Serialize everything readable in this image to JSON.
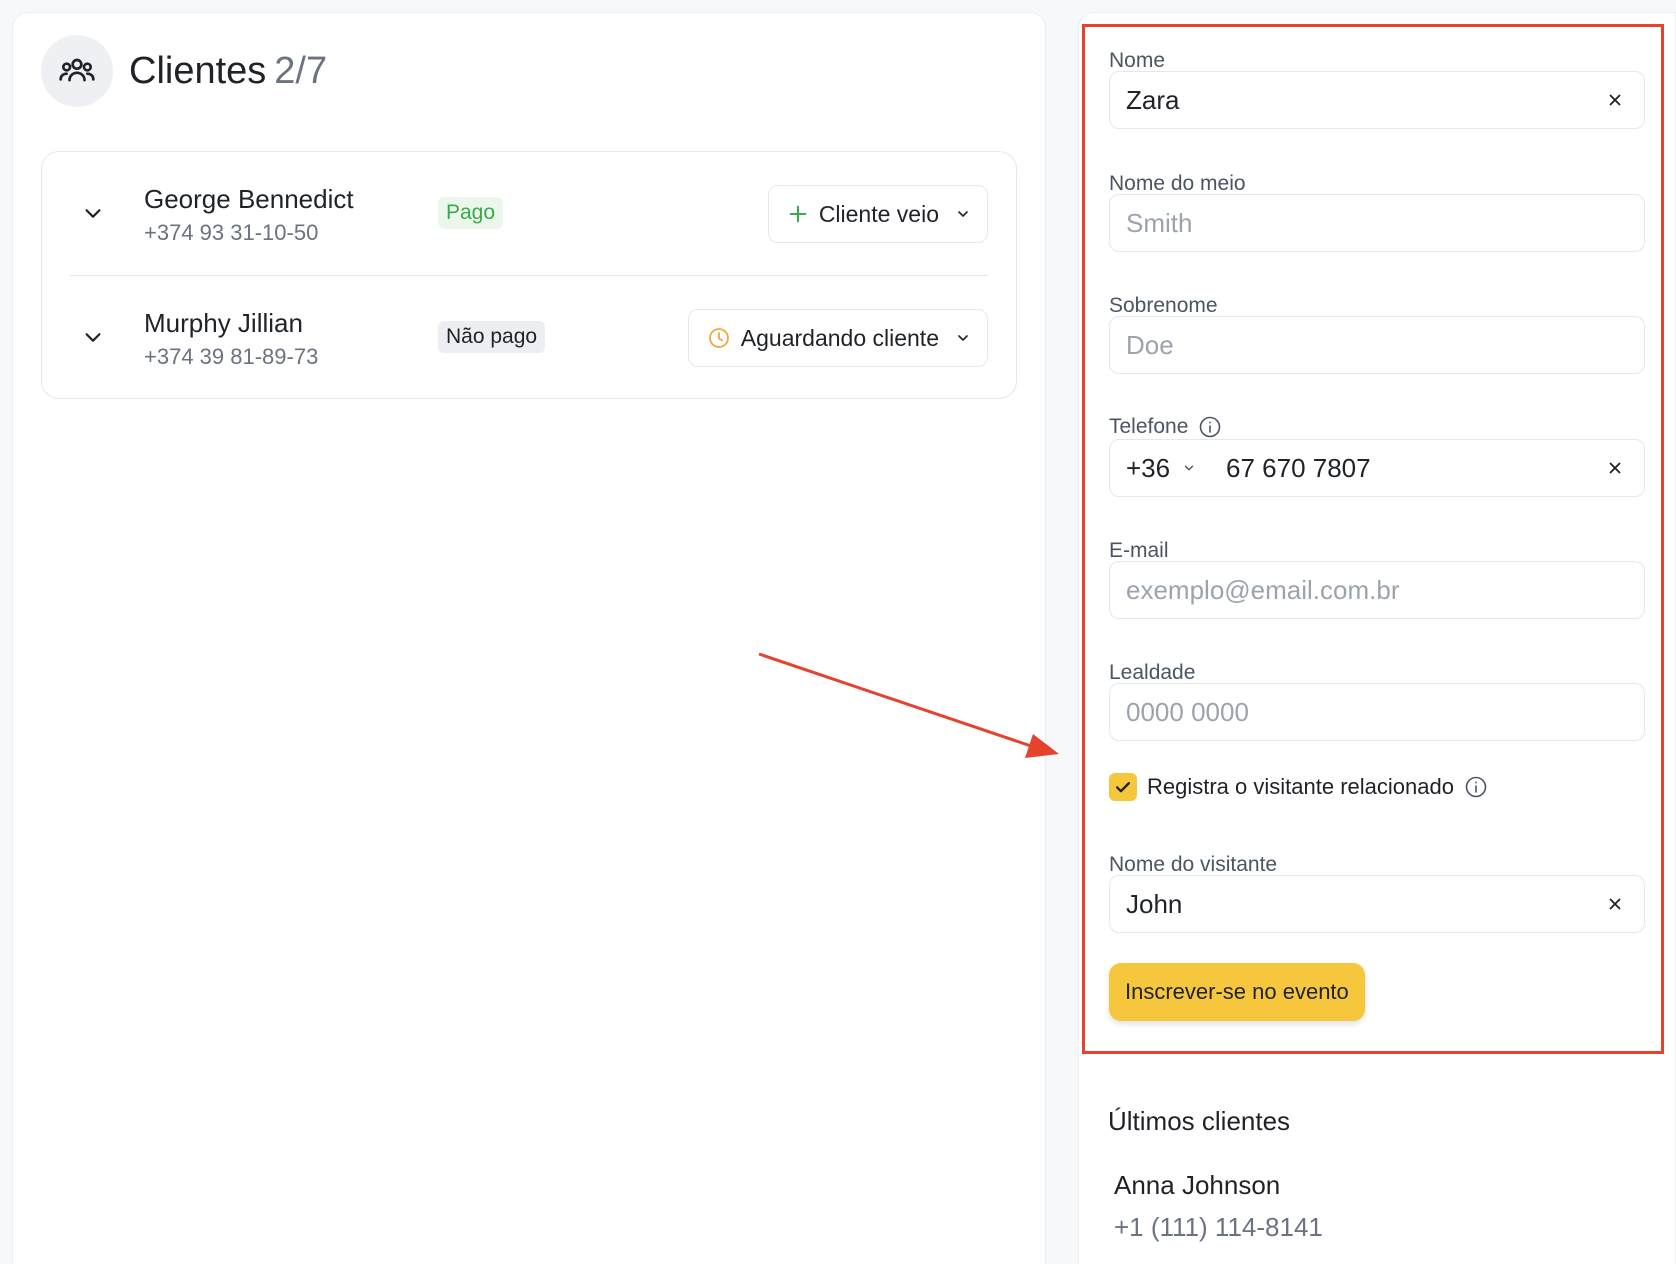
{
  "header": {
    "title": "Clientes",
    "count": "2/7",
    "icon": "users-icon"
  },
  "clients": [
    {
      "name": "George Bennedict",
      "phone": "+374 93 31-10-50",
      "badge": "Pago",
      "status": "Cliente veio",
      "status_icon": "plus-icon"
    },
    {
      "name": "Murphy Jillian",
      "phone": "+374 39 81-89-73",
      "badge": "Não pago",
      "status": "Aguardando cliente",
      "status_icon": "clock-icon"
    }
  ],
  "form": {
    "first_name": {
      "label": "Nome",
      "value": "Zara",
      "placeholder": ""
    },
    "middle_name": {
      "label": "Nome do meio",
      "value": "",
      "placeholder": "Smith"
    },
    "last_name": {
      "label": "Sobrenome",
      "value": "",
      "placeholder": "Doe"
    },
    "phone": {
      "label": "Telefone",
      "code": "+36",
      "value": "67 670 7807",
      "placeholder": ""
    },
    "email": {
      "label": "E-mail",
      "value": "",
      "placeholder": "exemplo@email.com.br"
    },
    "loyalty": {
      "label": "Lealdade",
      "value": "",
      "placeholder": "0000 0000"
    },
    "related_visitor": {
      "label": "Registra o visitante relacionado",
      "checked": true
    },
    "visitor_name": {
      "label": "Nome do visitante",
      "value": "John",
      "placeholder": ""
    },
    "submit_label": "Inscrever-se no evento"
  },
  "recent": {
    "title": "Últimos clientes",
    "items": [
      {
        "name": "Anna Johnson",
        "phone": "+1 (111) 114-8141"
      }
    ]
  },
  "colors": {
    "accent": "#f6c73d",
    "highlight": "#e5432e",
    "paid": "#3aa94a",
    "clock": "#f2a93b",
    "plus": "#3aa94a"
  }
}
